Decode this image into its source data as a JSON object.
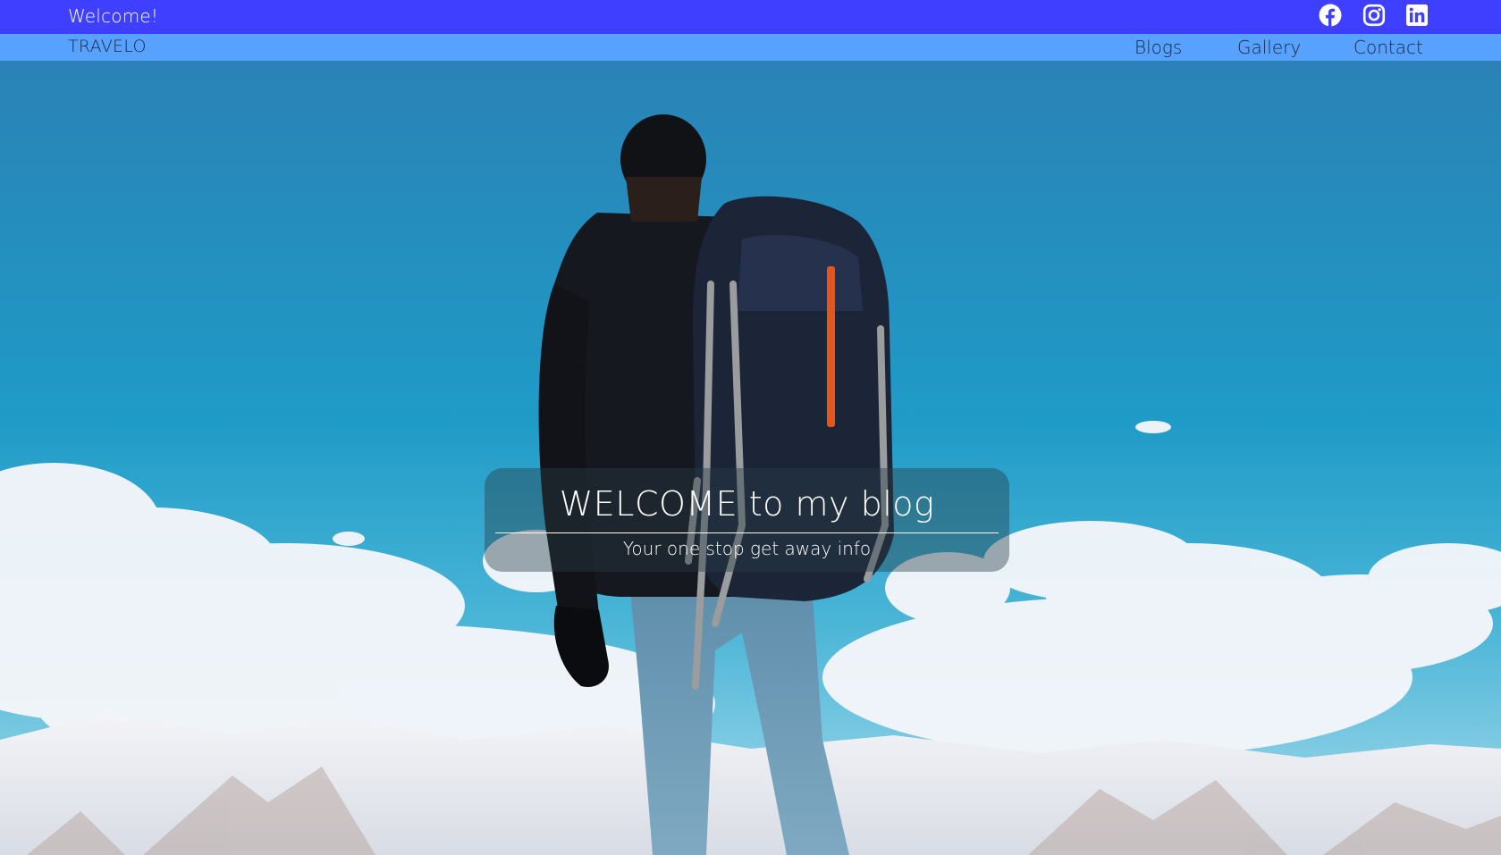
{
  "topbar": {
    "welcome_text": "Welcome!",
    "background_color": "#3f3fff",
    "social_icons": [
      "facebook-icon",
      "instagram-icon",
      "linkedin-icon"
    ]
  },
  "navbar": {
    "brand": "TRAVELO",
    "background_color": "#57a2ff",
    "links": [
      {
        "label": "Blogs"
      },
      {
        "label": "Gallery"
      },
      {
        "label": "Contact"
      }
    ]
  },
  "hero": {
    "title": "WELCOME to my blog",
    "subtitle": "Your one stop get away info"
  }
}
